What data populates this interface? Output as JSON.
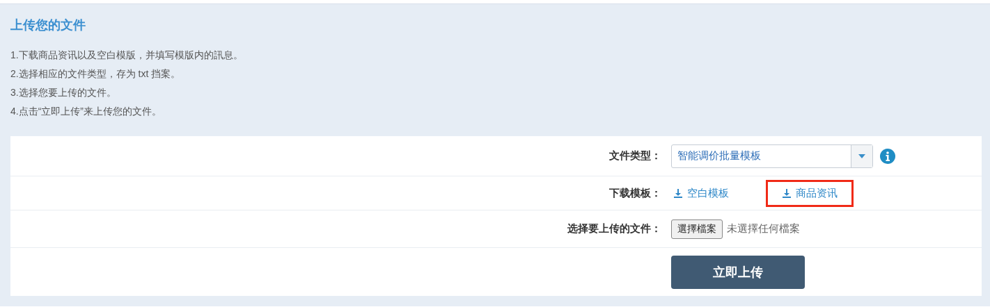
{
  "title": "上传您的文件",
  "instructions": [
    "1.下载商品资讯以及空白模版，并填写模版内的訊息。",
    "2.选择相应的文件类型，存为 txt 挡案。",
    "3.选择您要上传的文件。",
    "4.点击“立即上传”来上传您的文件。"
  ],
  "file_type": {
    "label": "文件类型：",
    "value": "智能调价批量模板"
  },
  "download": {
    "label": "下载模板：",
    "links": [
      {
        "text": "空白模板",
        "highlighted": false
      },
      {
        "text": "商品资讯",
        "highlighted": true
      }
    ]
  },
  "file_select": {
    "label": "选择要上传的文件：",
    "button": "選擇檔案",
    "status": "未選擇任何檔案"
  },
  "submit": "立即上传"
}
